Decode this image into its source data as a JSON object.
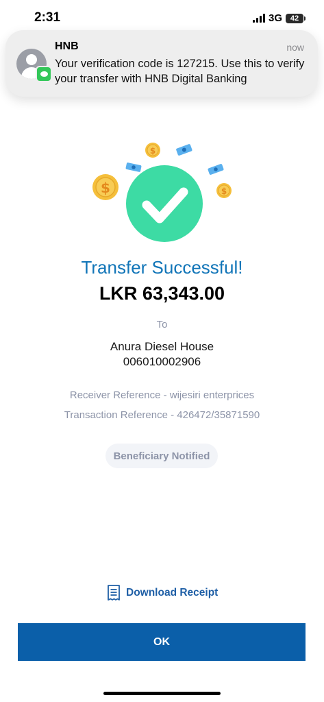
{
  "status_bar": {
    "time": "2:31",
    "network": "3G",
    "battery": "42"
  },
  "notification": {
    "app": "HNB",
    "time": "now",
    "message": "Your verification code is 127215. Use this to verify your transfer with HNB Digital Banking"
  },
  "illustration": {
    "success_icon": "checkmark-icon",
    "decor": [
      "coin-icon",
      "banknote-icon"
    ]
  },
  "result": {
    "title": "Transfer Successful!",
    "amount": "LKR 63,343.00",
    "to_label": "To",
    "recipient_name": "Anura Diesel House",
    "recipient_account": "006010002906",
    "receiver_reference": "Receiver Reference - wijesiri enterprices",
    "transaction_reference": "Transaction Reference - 426472/35871590",
    "status_badge": "Beneficiary Notified"
  },
  "actions": {
    "download_receipt": "Download Receipt",
    "ok": "OK"
  },
  "colors": {
    "accent_blue": "#1175b8",
    "button_blue": "#0b5fa9",
    "success_green": "#3ddba4",
    "coin_gold": "#f5bf3b",
    "muted_text": "#8d94a8"
  }
}
